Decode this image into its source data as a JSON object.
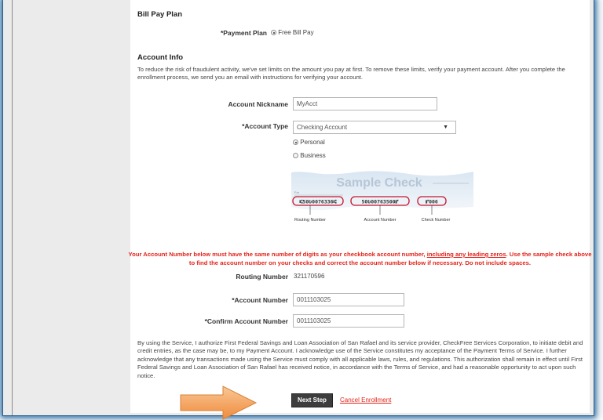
{
  "bill_pay_plan": {
    "heading": "Bill Pay Plan",
    "payment_plan_label": "*Payment Plan",
    "payment_plan_value": "Free Bill Pay"
  },
  "account_info": {
    "heading": "Account Info",
    "intro": "To reduce the risk of fraudulent activity, we've set limits on the amount you pay at first. To remove these limits, verify your payment account. After you complete the enrollment process, we send you an email with instructions for verifying your account.",
    "nickname_label": "Account Nickname",
    "nickname_value": "MyAcct",
    "type_label": "*Account Type",
    "type_value": "Checking Account",
    "type_options": [
      "Personal",
      "Business"
    ],
    "type_selected": "Personal"
  },
  "sample_check": {
    "title": "Sample Check",
    "for_label": "For",
    "routing_digits": "⑆50Ʋ0076336⑆",
    "account_digits": "50Ʋ00763500⑈",
    "check_digits": "⑈006",
    "routing_caption": "Routing Number",
    "account_caption": "Account Number",
    "check_caption": "Check Number"
  },
  "warning": {
    "part1": "Your Account Number below must have the same number of digits as your checkbook account number, ",
    "underlined": "including any leading zeros",
    "part2": ". Use the sample check above to find the account number on your checks and correct the account number below if necessary. Do not include spaces."
  },
  "routing": {
    "label": "Routing Number",
    "value": "321170596"
  },
  "account_number": {
    "label": "*Account Number",
    "value": "0011103025"
  },
  "confirm_account": {
    "label": "*Confirm Account Number",
    "value": "0011103025"
  },
  "terms": "By using the Service, I authorize First Federal Savings and Loan Association of San Rafael and its service provider, CheckFree Services Corporation, to initiate debit and credit entries, as the case may be, to my Payment Account. I acknowledge use of the Service constitutes my acceptance of the Payment Terms of Service. I further acknowledge that any transactions made using the Service must comply with all applicable laws, rules, and regulations. This authorization shall remain in effect until First Federal Savings and Loan Association of San Rafael has received notice, in accordance with the Terms of Service, and had a reasonable opportunity to act upon such notice.",
  "actions": {
    "next_label": "Next Step",
    "cancel_label": "Cancel Enrollment"
  },
  "colors": {
    "warning": "#e2231a",
    "arrow": "#f5a862",
    "frame_glow": "#3a78ad"
  },
  "icons": [
    "dropdown-arrow-icon",
    "radio-icon",
    "pointer-arrow-icon"
  ]
}
